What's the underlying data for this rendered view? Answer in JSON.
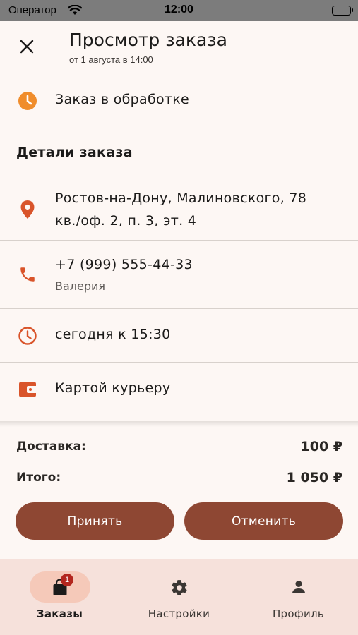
{
  "status_bar": {
    "carrier": "Оператор",
    "time": "12:00"
  },
  "header": {
    "title": "Просмотр заказа",
    "subtitle": "от 1 августа в 14:00"
  },
  "order_status": {
    "label": "Заказ в обработке",
    "icon": "clock-filled-icon",
    "color": "#f08d2c"
  },
  "details": {
    "section_title": "Детали заказа",
    "address": {
      "line1": "Ростов-на-Дону, Малиновского, 78",
      "line2": "кв./оф. 2, п. 3, эт. 4",
      "icon": "location-pin-icon"
    },
    "phone": {
      "number": "+7 (999) 555-44-33",
      "name": "Валерия",
      "icon": "phone-icon"
    },
    "time": {
      "label": "сегодня к 15:30",
      "icon": "clock-outline-icon"
    },
    "payment": {
      "label": "Картой курьеру",
      "icon": "wallet-icon"
    },
    "icon_color": "#d9542a"
  },
  "summary": {
    "delivery_label": "Доставка:",
    "delivery_value": "100 ₽",
    "total_label": "Итого:",
    "total_value": "1 050 ₽"
  },
  "actions": {
    "accept_label": "Принять",
    "cancel_label": "Отменить",
    "button_color": "#8e4733"
  },
  "tabbar": {
    "tabs": [
      {
        "label": "Заказы",
        "icon": "shopping-bag-icon",
        "badge": "1",
        "active": true
      },
      {
        "label": "Настройки",
        "icon": "gear-icon",
        "active": false
      },
      {
        "label": "Профиль",
        "icon": "person-icon",
        "active": false
      }
    ]
  }
}
